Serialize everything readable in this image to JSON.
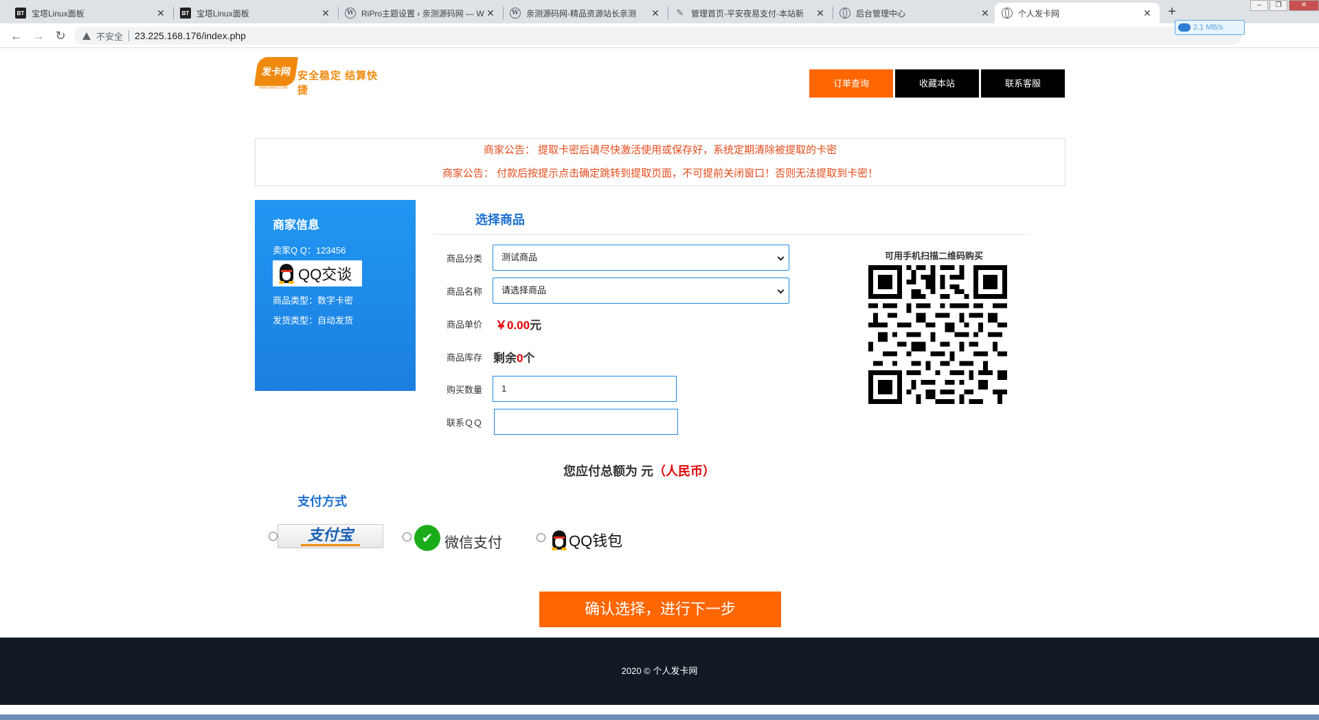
{
  "browser": {
    "tabs": [
      {
        "label": "宝塔Linux面板",
        "icon": "bt-icon"
      },
      {
        "label": "宝塔Linux面板",
        "icon": "bt-icon"
      },
      {
        "label": "RiPro主题设置 ‹ 亲测源码网 — W",
        "icon": "wordpress-icon"
      },
      {
        "label": "亲测源码网-精品资源站长亲测",
        "icon": "wordpress-icon"
      },
      {
        "label": "管理首页-平安夜易支付-本站新",
        "icon": "feather-icon"
      },
      {
        "label": "后台管理中心",
        "icon": "globe-icon"
      },
      {
        "label": "个人发卡网",
        "icon": "globe-icon",
        "active": true
      }
    ],
    "insecure_label": "不安全",
    "url": "23.225.168.176/index.php",
    "speed_label": "2.1 MB/s"
  },
  "header": {
    "logo_text": "发卡网",
    "slogan": "安全稳定 结算快捷",
    "logo_domain": "www.fake.COM",
    "nav": [
      {
        "label": "订单查询"
      },
      {
        "label": "收藏本站"
      },
      {
        "label": "联系客服"
      }
    ]
  },
  "notice": {
    "lines": [
      "商家公告： 提取卡密后请尽快激活使用或保存好，系统定期清除被提取的卡密",
      "商家公告： 付款后按提示点击确定跳转到提取页面，不可提前关闭窗口！否则无法提取到卡密！"
    ]
  },
  "merchant": {
    "title": "商家信息",
    "qq_line": "卖家Q Q：123456",
    "qq_chat_label": "QQ交谈",
    "type_line": "商品类型：数字卡密",
    "delivery_line": "发货类型：自动发货"
  },
  "form": {
    "title": "选择商品",
    "category_label": "商品分类",
    "category_value": "测试商品",
    "name_label": "商品名称",
    "name_value": "请选择商品",
    "price_label": "商品单价",
    "price_value": "￥0.00",
    "price_unit": "元",
    "stock_label": "商品库存",
    "stock_prefix": "剩余",
    "stock_value": "0",
    "stock_unit": "个",
    "qty_label": "购买数量",
    "qty_value": "1",
    "contact_label": "联系ＱＱ",
    "contact_value": ""
  },
  "qr": {
    "caption": "可用手机扫描二维码购买"
  },
  "total": {
    "prefix": "您应付总额为 元",
    "currency": "（人民币）"
  },
  "payment": {
    "title": "支付方式",
    "options": [
      {
        "label": "支付宝",
        "icon": "alipay-icon"
      },
      {
        "label": "微信支付",
        "icon": "wechat-icon"
      },
      {
        "label": "QQ钱包",
        "icon": "qq-penguin-icon"
      }
    ],
    "confirm_label": "确认选择，进行下一步"
  },
  "footer": {
    "copyright": "2020 © 个人发卡网"
  },
  "colors": {
    "accent_orange": "#ff6600",
    "blue": "#1e88e5",
    "red": "#e30000",
    "footer_bg": "#111a24"
  }
}
